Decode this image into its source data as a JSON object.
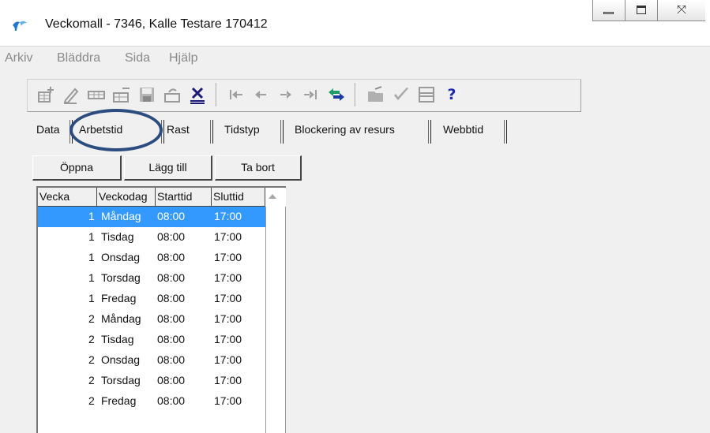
{
  "window": {
    "title": "Veckomall - 7346, Kalle Testare 170412"
  },
  "menu": [
    "Arkiv",
    "Bläddra",
    "Sida",
    "Hjälp"
  ],
  "toolbar": {
    "icons": [
      "new-record-icon",
      "edit-icon",
      "insert-row-icon",
      "delete-row-icon",
      "save-icon",
      "undo-icon",
      "cancel-icon",
      "first-record-icon",
      "previous-record-icon",
      "next-record-icon",
      "last-record-icon",
      "refresh-icon",
      "open-folder-icon",
      "check-icon",
      "split-view-icon",
      "help-icon"
    ],
    "help_glyph": "?"
  },
  "tabs": [
    "Data",
    "Arbetstid",
    "Rast",
    "Tidstyp",
    "Blockering av resurs",
    "Webbtid"
  ],
  "active_tab": "Arbetstid",
  "buttons": {
    "open": "Öppna",
    "add": "Lägg till",
    "remove": "Ta bort"
  },
  "list": {
    "columns": [
      "Vecka",
      "Veckodag",
      "Starttid",
      "Sluttid"
    ],
    "rows": [
      {
        "week": "1",
        "day": "Måndag",
        "start": "08:00",
        "end": "17:00",
        "selected": true
      },
      {
        "week": "1",
        "day": "Tisdag",
        "start": "08:00",
        "end": "17:00"
      },
      {
        "week": "1",
        "day": "Onsdag",
        "start": "08:00",
        "end": "17:00"
      },
      {
        "week": "1",
        "day": "Torsdag",
        "start": "08:00",
        "end": "17:00"
      },
      {
        "week": "1",
        "day": "Fredag",
        "start": "08:00",
        "end": "17:00"
      },
      {
        "week": "2",
        "day": "Måndag",
        "start": "08:00",
        "end": "17:00"
      },
      {
        "week": "2",
        "day": "Tisdag",
        "start": "08:00",
        "end": "17:00"
      },
      {
        "week": "2",
        "day": "Onsdag",
        "start": "08:00",
        "end": "17:00"
      },
      {
        "week": "2",
        "day": "Torsdag",
        "start": "08:00",
        "end": "17:00"
      },
      {
        "week": "2",
        "day": "Fredag",
        "start": "08:00",
        "end": "17:00"
      }
    ]
  },
  "colors": {
    "selection": "#3399ff",
    "annotation": "#2c4c7f"
  }
}
